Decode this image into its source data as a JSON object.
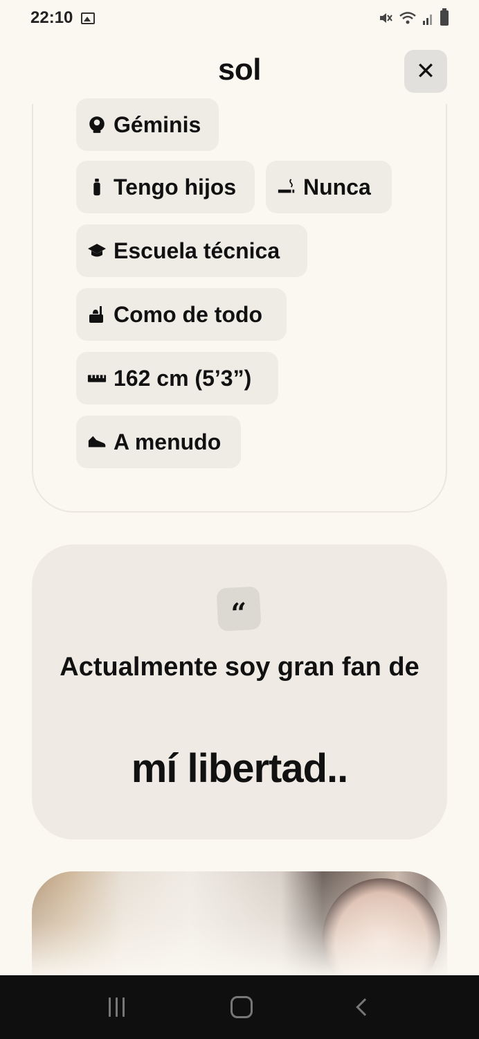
{
  "status_bar": {
    "time": "22:10",
    "icons": [
      "image-icon",
      "mute-icon",
      "wifi-icon",
      "signal-icon",
      "battery-icon"
    ]
  },
  "header": {
    "title": "sol",
    "close_icon": "close-icon",
    "close_glyph": "✕"
  },
  "basics": [
    {
      "icon": "zodiac-icon",
      "glyph": "♊",
      "label": "Géminis"
    },
    {
      "icon": "baby-bottle-icon",
      "glyph": "🍼",
      "label": "Tengo hijos"
    },
    {
      "icon": "smoking-icon",
      "glyph": "🚬",
      "label": "Nunca"
    },
    {
      "icon": "graduation-cap-icon",
      "glyph": "🎓",
      "label": "Escuela técnica"
    },
    {
      "icon": "food-icon",
      "glyph": "🍴",
      "label": "Como de todo"
    },
    {
      "icon": "ruler-icon",
      "glyph": "📏",
      "label": "162 cm (5’3”)"
    },
    {
      "icon": "sneaker-icon",
      "glyph": "👟",
      "label": "A menudo"
    }
  ],
  "prompt": {
    "quote_icon": "quote-icon",
    "quote_glyph": "“",
    "question": "Actualmente soy gran fan de",
    "answer": "mí libertad.."
  },
  "photo": {
    "alt": "profile-photo"
  },
  "nav": {
    "recent": "recent-apps-icon",
    "home": "home-icon",
    "back": "back-icon"
  },
  "colors": {
    "background": "#fbf8f2",
    "chip": "#efece6",
    "card": "#efebe4",
    "nav": "#0f0f0f"
  }
}
